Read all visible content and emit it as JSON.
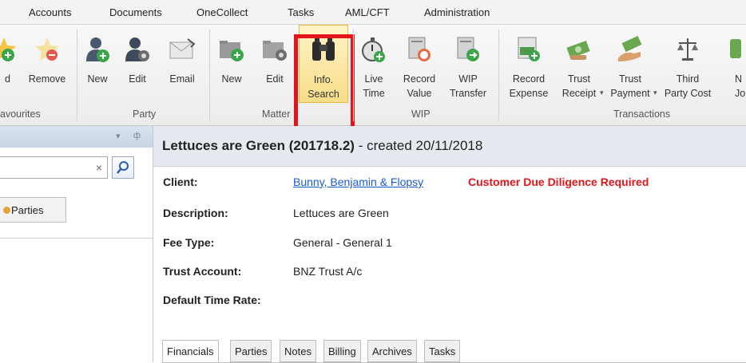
{
  "menu": [
    "Accounts",
    "Documents",
    "OneCollect",
    "Tasks",
    "AML/CFT",
    "Administration"
  ],
  "ribbon": {
    "buttons": {
      "add": {
        "label": "d"
      },
      "remove": {
        "label": "Remove"
      },
      "party_new": {
        "label": "New"
      },
      "party_edit": {
        "label": "Edit"
      },
      "party_email": {
        "label": "Email"
      },
      "matter_new": {
        "label": "New"
      },
      "matter_edit": {
        "label": "Edit"
      },
      "info_search": {
        "line1": "Info.",
        "line2": "Search"
      },
      "live_time": {
        "line1": "Live",
        "line2": "Time"
      },
      "record_value": {
        "line1": "Record",
        "line2": "Value"
      },
      "wip_transfer": {
        "line1": "WIP",
        "line2": "Transfer"
      },
      "record_expense": {
        "line1": "Record",
        "line2": "Expense"
      },
      "trust_receipt": {
        "line1": "Trust",
        "line2": "Receipt"
      },
      "trust_payment": {
        "line1": "Trust",
        "line2": "Payment"
      },
      "third_party_cost": {
        "line1": "Third",
        "line2": "Party Cost"
      },
      "journal": {
        "line1": "N",
        "line2": "Jo"
      }
    },
    "groups": {
      "favourites": "avourites",
      "party": "Party",
      "matter": "Matter",
      "wip": "WIP",
      "transactions": "Transactions"
    }
  },
  "left_panel": {
    "pin_glyphs": "▾  ⊥",
    "search": {
      "value": "",
      "placeholder": ""
    },
    "clear_glyph": "×",
    "parties_tab": "Parties"
  },
  "matter": {
    "title": "Lettuces are Green (201718.2)",
    "created": " - created 20/11/2018",
    "fields": {
      "client_label": "Client:",
      "client_value": "Bunny, Benjamin & Flopsy",
      "cdd_warning": "Customer Due Diligence Required",
      "description_label": "Description:",
      "description_value": "Lettuces are Green",
      "fee_type_label": "Fee Type:",
      "fee_type_value": "General - General 1",
      "trust_account_label": "Trust Account:",
      "trust_account_value": "BNZ Trust A/c",
      "default_time_rate_label": "Default Time Rate:"
    },
    "tabs": [
      "Financials",
      "Parties",
      "Notes",
      "Billing",
      "Archives",
      "Tasks"
    ]
  },
  "colors": {
    "highlight": "#e3151a",
    "link": "#1a5bd3",
    "header_bg": "#e6eaf0"
  }
}
